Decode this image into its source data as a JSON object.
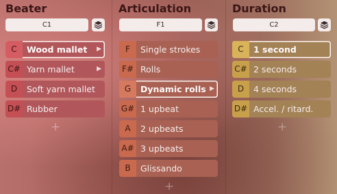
{
  "beater": {
    "title": "Beater",
    "selector_value": "C1",
    "items": [
      {
        "note": "C",
        "label": "Wood mallet",
        "selected": true,
        "has_submenu": true
      },
      {
        "note": "C#",
        "label": "Yarn mallet",
        "selected": false,
        "has_submenu": true
      },
      {
        "note": "D",
        "label": "Soft yarn mallet",
        "selected": false,
        "has_submenu": false
      },
      {
        "note": "D#",
        "label": "Rubber",
        "selected": false,
        "has_submenu": false
      }
    ],
    "add_label": "+"
  },
  "articulation": {
    "title": "Articulation",
    "selector_value": "F1",
    "items": [
      {
        "note": "F",
        "label": "Single strokes",
        "selected": false
      },
      {
        "note": "F#",
        "label": "Rolls",
        "selected": false
      },
      {
        "note": "G",
        "label": "Dynamic rolls",
        "selected": true,
        "has_submenu": true
      },
      {
        "note": "G#",
        "label": "1 upbeat",
        "selected": false
      },
      {
        "note": "A",
        "label": "2 upbeats",
        "selected": false
      },
      {
        "note": "A#",
        "label": "3 upbeats",
        "selected": false
      },
      {
        "note": "B",
        "label": "Glissando",
        "selected": false
      }
    ],
    "add_label": "+"
  },
  "duration": {
    "title": "Duration",
    "selector_value": "C2",
    "items": [
      {
        "note": "C",
        "label": "1 second",
        "selected": true
      },
      {
        "note": "C#",
        "label": "2 seconds",
        "selected": false
      },
      {
        "note": "D",
        "label": "4 seconds",
        "selected": false
      },
      {
        "note": "D#",
        "label": "Accel. / ritard.",
        "selected": false
      }
    ],
    "add_label": "+"
  },
  "icons": {
    "layers": "layers-icon",
    "chevron": "chevron-right-icon",
    "add": "plus-icon"
  },
  "colors": {
    "beater_accent": "#c44f55",
    "articulation_accent": "#c9694e",
    "duration_accent": "#c8a04c"
  }
}
